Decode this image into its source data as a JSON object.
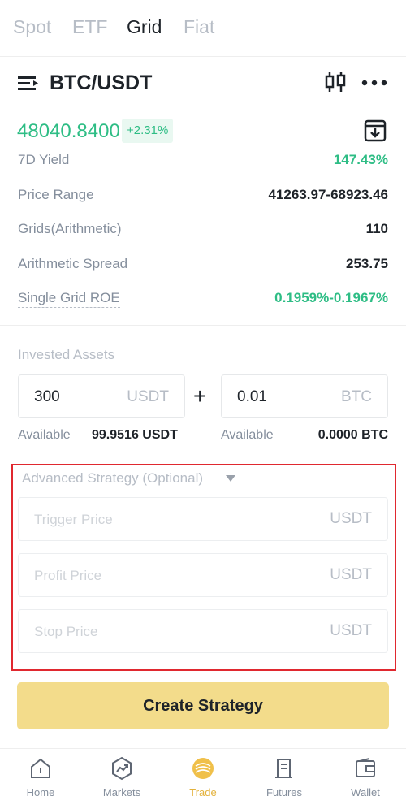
{
  "tabs": [
    {
      "label": "Spot",
      "active": false
    },
    {
      "label": "ETF",
      "active": false
    },
    {
      "label": "Grid",
      "active": true
    },
    {
      "label": "Fiat",
      "active": false
    }
  ],
  "header": {
    "pair": "BTC/USDT",
    "icons": [
      "menu-icon",
      "candlestick-icon",
      "more-icon"
    ]
  },
  "ticker": {
    "price": "48040.8400",
    "change": "+2.31%",
    "icon": "download-icon"
  },
  "stats": [
    {
      "label": "7D Yield",
      "value": "147.43%"
    },
    {
      "label": "Price Range",
      "value": "41263.97-68923.46"
    },
    {
      "label": "Grids(Arithmetic)",
      "value": "110"
    },
    {
      "label": "Arithmetic Spread",
      "value": "253.75"
    },
    {
      "label": "Single Grid ROE",
      "value": "0.1959%-0.1967%"
    }
  ],
  "invested": {
    "label": "Invested Assets",
    "usdt_value": "300",
    "usdt_unit": "USDT",
    "plus": "+",
    "btc_value": "0.01",
    "btc_unit": "BTC",
    "available_label": "Available",
    "usdt_available": "99.9516 USDT",
    "btc_available": "0.0000 BTC"
  },
  "advanced": {
    "title": "Advanced Strategy (Optional)",
    "trigger_placeholder": "Trigger Price",
    "profit_placeholder": "Profit Price",
    "stop_placeholder": "Stop Price",
    "unit": "USDT"
  },
  "action": {
    "create_label": "Create Strategy"
  },
  "nav": [
    {
      "label": "Home",
      "icon": "home-icon",
      "active": false
    },
    {
      "label": "Markets",
      "icon": "markets-icon",
      "active": false
    },
    {
      "label": "Trade",
      "icon": "trade-icon",
      "active": true
    },
    {
      "label": "Futures",
      "icon": "futures-icon",
      "active": false
    },
    {
      "label": "Wallet",
      "icon": "wallet-icon",
      "active": false
    }
  ],
  "colors": {
    "positive": "#2ebd85",
    "accent": "#e3b23c",
    "button": "#f3dc8b",
    "highlight_border": "#e0282f"
  }
}
